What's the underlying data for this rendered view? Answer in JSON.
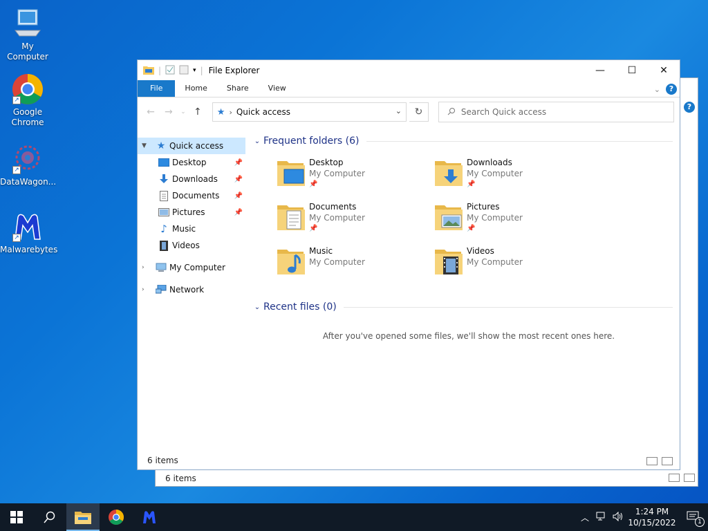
{
  "desktop": {
    "icons": [
      {
        "label": "My Computer"
      },
      {
        "label": "Google Chrome"
      },
      {
        "label": "DataWagon..."
      },
      {
        "label": "Malwarebytes"
      }
    ]
  },
  "back_window": {
    "status": "6 items"
  },
  "window": {
    "title": "File Explorer",
    "ribbon_tabs": [
      "File",
      "Home",
      "Share",
      "View"
    ],
    "address": {
      "location": "Quick access"
    },
    "search": {
      "placeholder": "Search Quick access"
    },
    "nav": {
      "quick_access": "Quick access",
      "pinned": [
        {
          "label": "Desktop",
          "pinned": true
        },
        {
          "label": "Downloads",
          "pinned": true
        },
        {
          "label": "Documents",
          "pinned": true
        },
        {
          "label": "Pictures",
          "pinned": true
        },
        {
          "label": "Music",
          "pinned": false
        },
        {
          "label": "Videos",
          "pinned": false
        }
      ],
      "my_computer": "My Computer",
      "network": "Network"
    },
    "frequent": {
      "header": "Frequent folders (6)",
      "folders": [
        {
          "name": "Desktop",
          "location": "My Computer",
          "pinned": true
        },
        {
          "name": "Downloads",
          "location": "My Computer",
          "pinned": true
        },
        {
          "name": "Documents",
          "location": "My Computer",
          "pinned": true
        },
        {
          "name": "Pictures",
          "location": "My Computer",
          "pinned": true
        },
        {
          "name": "Music",
          "location": "My Computer",
          "pinned": false
        },
        {
          "name": "Videos",
          "location": "My Computer",
          "pinned": false
        }
      ]
    },
    "recent": {
      "header": "Recent files (0)",
      "empty_message": "After you've opened some files, we'll show the most recent ones here."
    },
    "status": "6 items"
  },
  "taskbar": {
    "time": "1:24 PM",
    "date": "10/15/2022",
    "notification_count": "1"
  },
  "colors": {
    "accent": "#1979ca",
    "selection": "#cce8ff",
    "folder": "#f4c95d"
  }
}
